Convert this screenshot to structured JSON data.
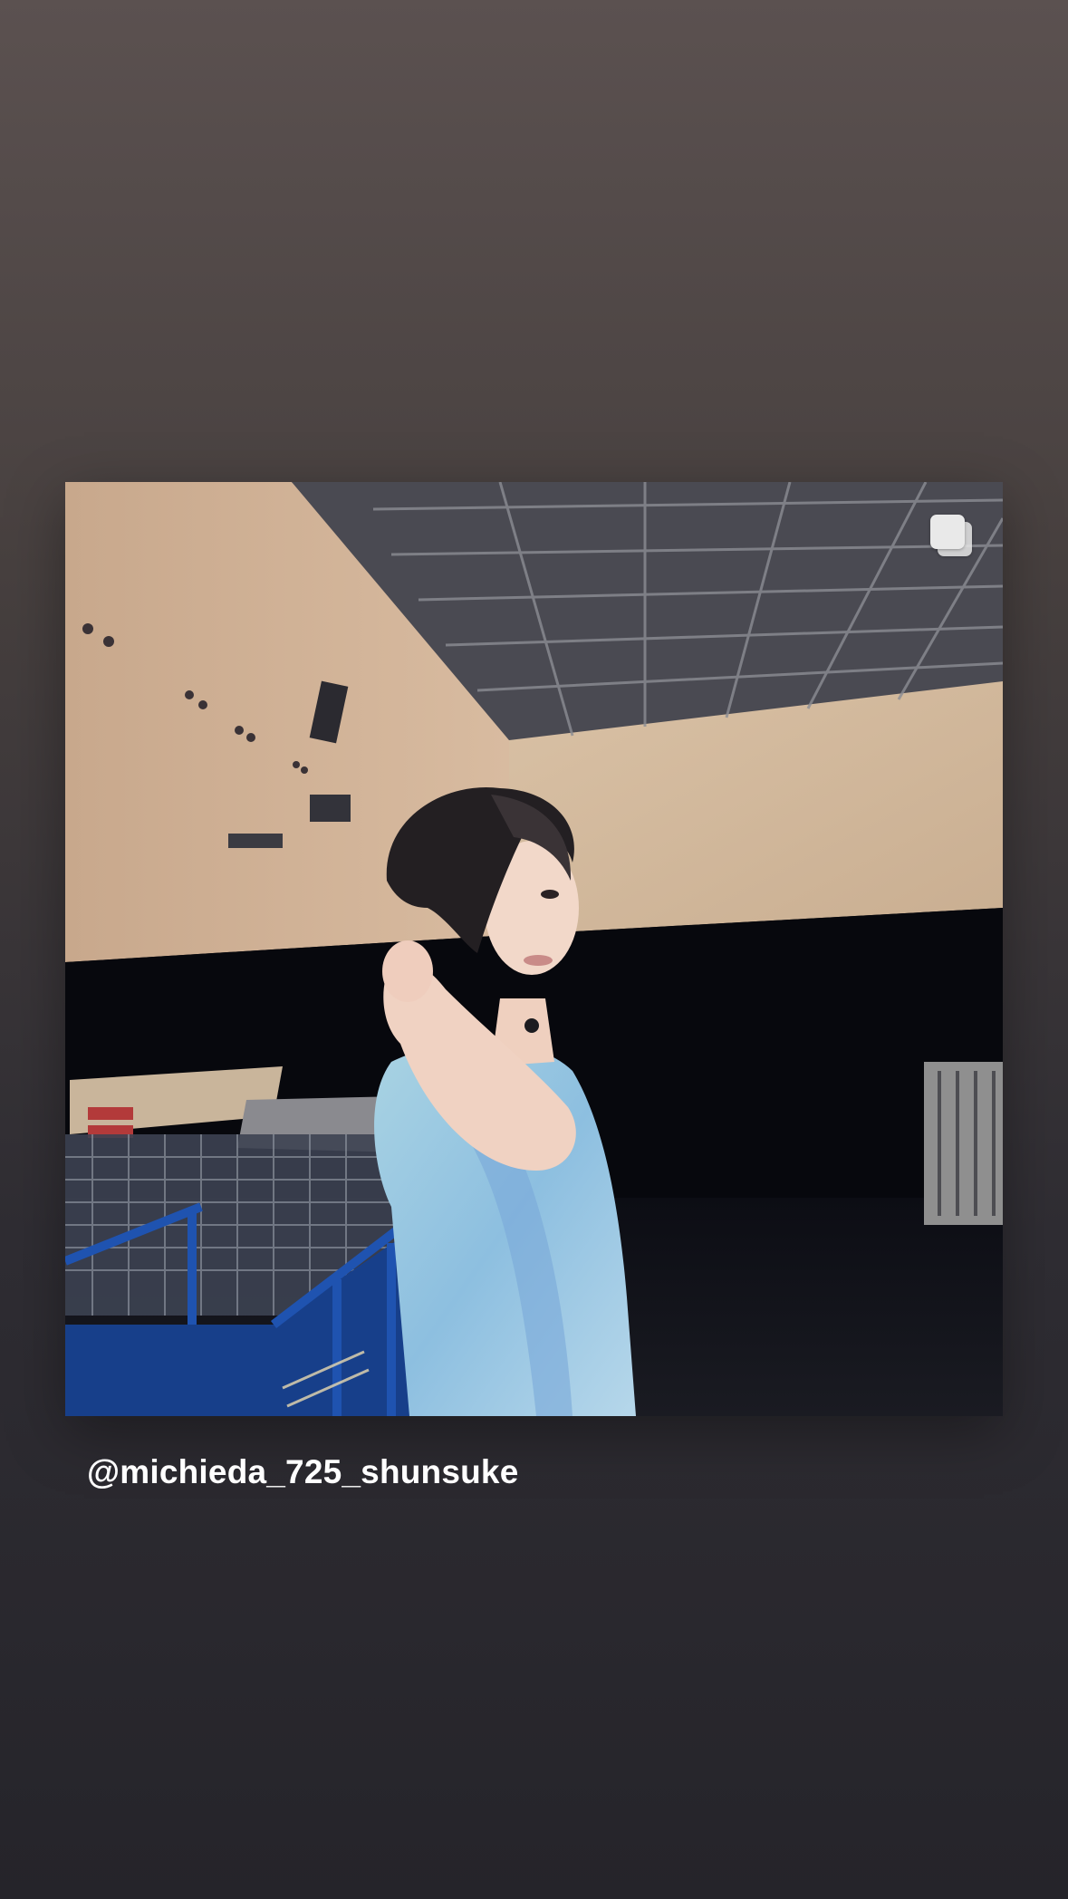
{
  "story": {
    "shared_post": {
      "photo_description_icon": "shared-post-photo",
      "carousel_indicator_icon": "carousel-multiple-icon"
    },
    "mention_sticker": {
      "text": "@michieda_725_shunsuke"
    }
  },
  "colors": {
    "background_top": "#5b5150",
    "background_bottom": "#25242a",
    "mention_text": "#ffffff"
  }
}
